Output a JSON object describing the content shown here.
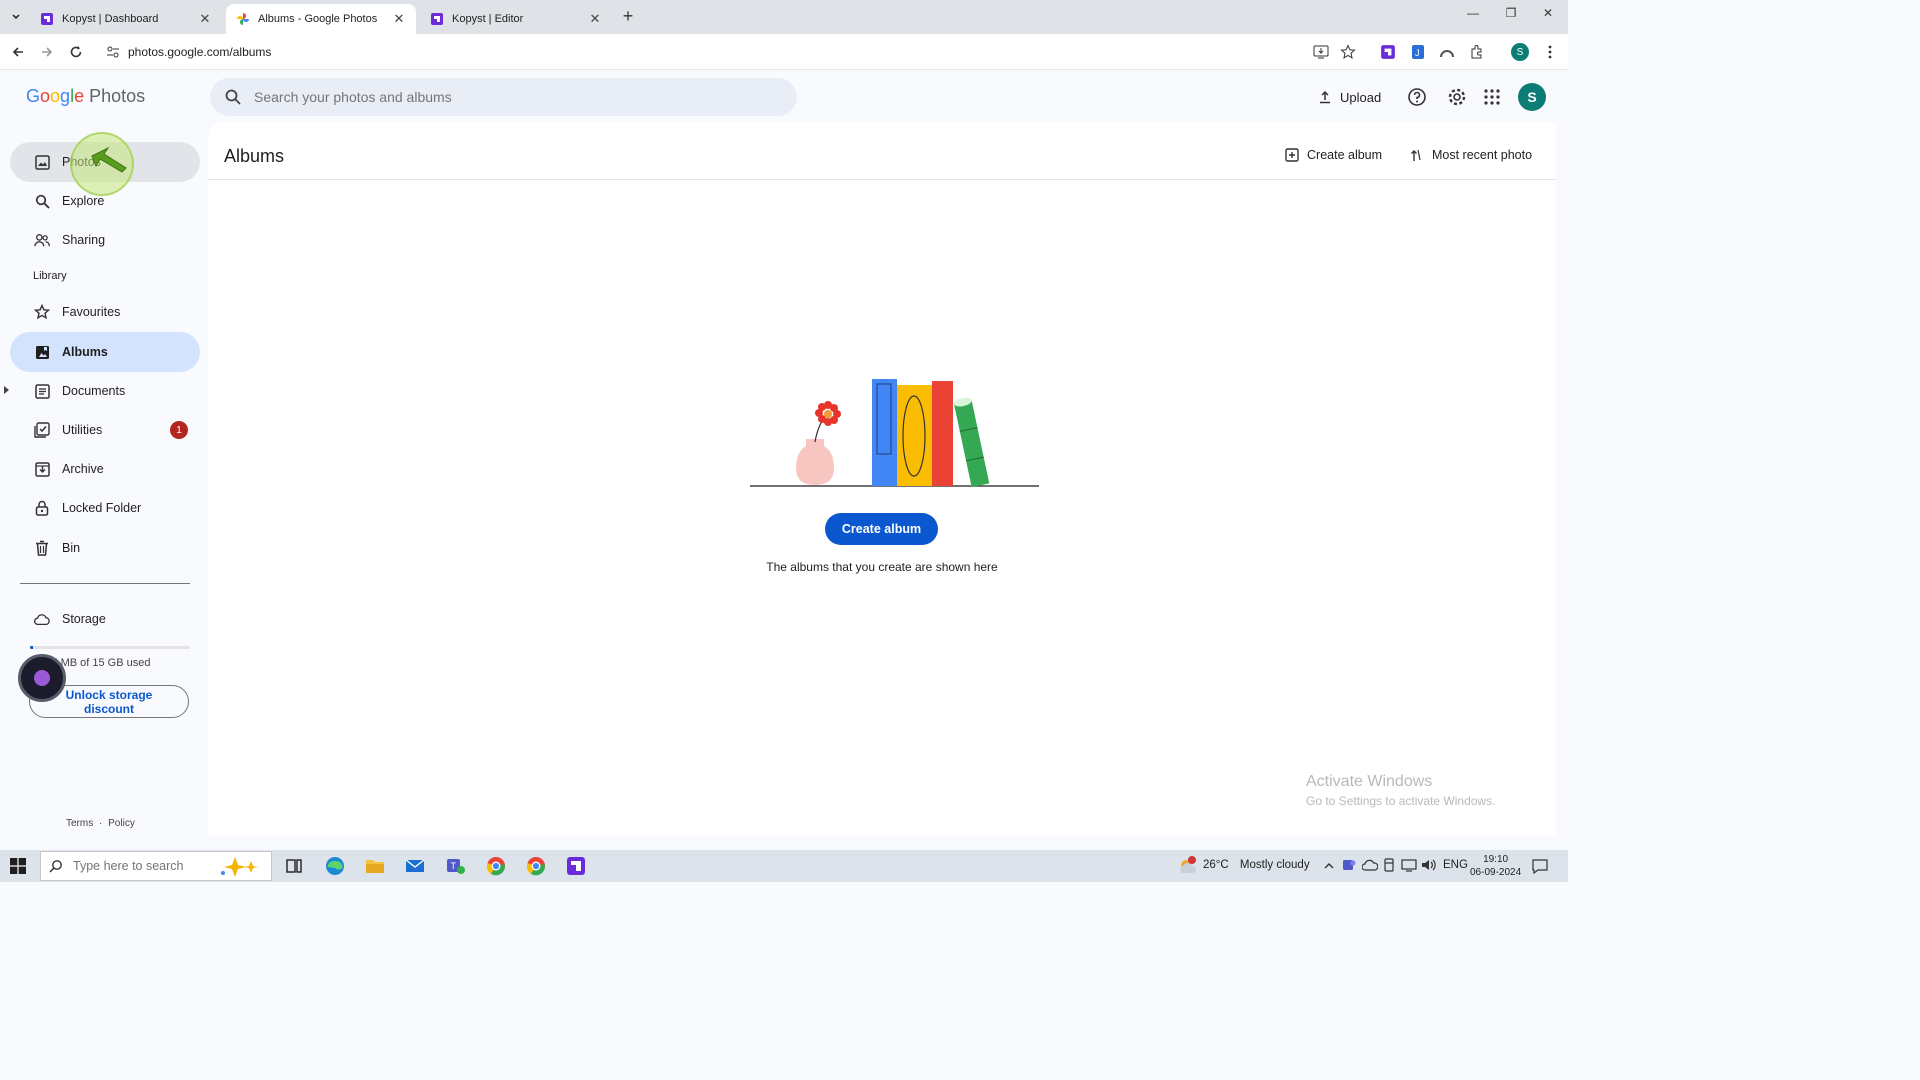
{
  "browser": {
    "tabs": [
      {
        "title": "Kopyst | Dashboard"
      },
      {
        "title": "Albums - Google Photos"
      },
      {
        "title": "Kopyst | Editor"
      }
    ],
    "url": "photos.google.com/albums"
  },
  "app": {
    "logo_google": [
      "G",
      "o",
      "o",
      "g",
      "l",
      "e"
    ],
    "logo_product": "Photos",
    "search_placeholder": "Search your photos and albums",
    "upload_label": "Upload",
    "avatar_initial": "S"
  },
  "sidebar": {
    "items": [
      {
        "label": "Photos",
        "icon": "photo-icon"
      },
      {
        "label": "Explore",
        "icon": "search-icon"
      },
      {
        "label": "Sharing",
        "icon": "people-icon"
      }
    ],
    "library_label": "Library",
    "library_items": [
      {
        "label": "Favourites",
        "icon": "star-icon"
      },
      {
        "label": "Albums",
        "icon": "album-icon",
        "selected": true
      },
      {
        "label": "Documents",
        "icon": "document-icon"
      },
      {
        "label": "Utilities",
        "icon": "utilities-icon",
        "badge": "1"
      },
      {
        "label": "Archive",
        "icon": "archive-icon"
      },
      {
        "label": "Locked Folder",
        "icon": "lock-icon"
      },
      {
        "label": "Bin",
        "icon": "trash-icon"
      }
    ],
    "storage_label": "Storage",
    "storage_used_text": "257.7 MB of 15 GB used",
    "storage_fraction": 0.017,
    "unlock_line1": "Unlock storage",
    "unlock_line2": "discount",
    "footer_terms": "Terms",
    "footer_sep": "·",
    "footer_policy": "Policy"
  },
  "main": {
    "title": "Albums",
    "create_album_action": "Create album",
    "most_recent_action": "Most recent photo",
    "create_album_button": "Create album",
    "empty_text": "The albums that you create are shown here"
  },
  "watermark": {
    "line1": "Activate Windows",
    "line2": "Go to Settings to activate Windows."
  },
  "taskbar": {
    "search_placeholder": "Type here to search",
    "weather_temp": "26°C",
    "weather_text": "Mostly cloudy",
    "language": "ENG",
    "time": "19:10",
    "date": "06-09-2024"
  },
  "colors": {
    "accent": "#0b57d0",
    "selected_nav": "#d3e3fd",
    "badge": "#b3261e",
    "avatar": "#0b7d74"
  }
}
